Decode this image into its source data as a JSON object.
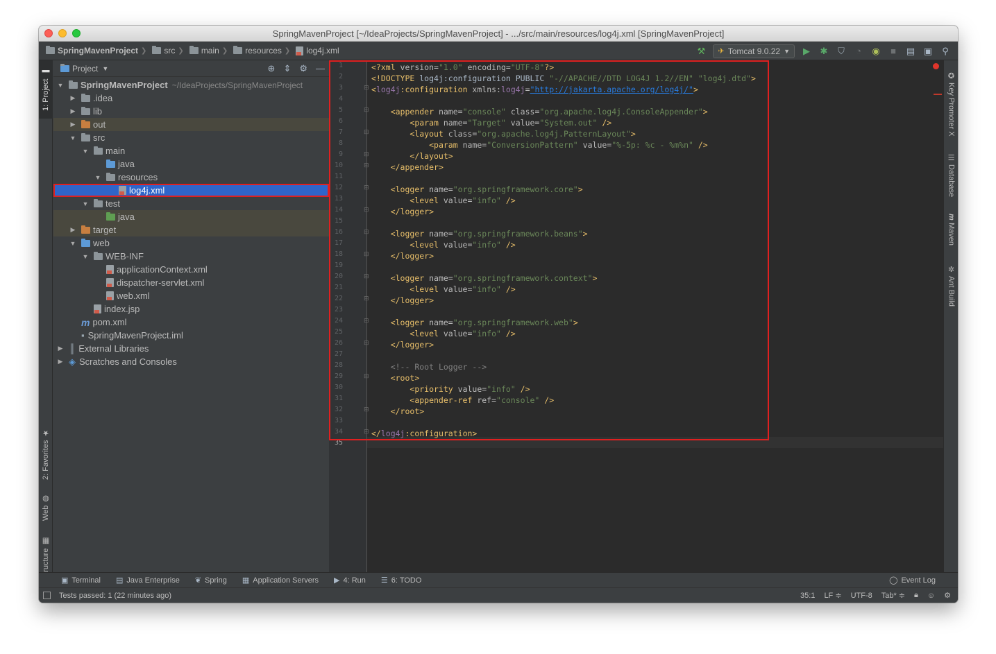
{
  "window": {
    "title": "SpringMavenProject [~/IdeaProjects/SpringMavenProject] - .../src/main/resources/log4j.xml [SpringMavenProject]"
  },
  "breadcrumbs": [
    "SpringMavenProject",
    "src",
    "main",
    "resources",
    "log4j.xml"
  ],
  "toolbar": {
    "run_config": "Tomcat 9.0.22",
    "icons": [
      "hammer-icon",
      "play-icon",
      "bug-icon",
      "coverage-icon",
      "profile-icon",
      "attach-icon",
      "stop-icon",
      "project-structure-icon",
      "frame-icon",
      "search-icon"
    ]
  },
  "left_tabs": [
    "1: Project",
    "2: Favorites",
    "Web",
    "Z: Structure"
  ],
  "right_tabs": [
    "Key Promoter X",
    "Database",
    "Maven",
    "Ant Build"
  ],
  "project_panel": {
    "title": "Project",
    "tree": [
      {
        "label": "SpringMavenProject",
        "hint": "~/IdeaProjects/SpringMavenProject",
        "depth": 0,
        "arrow": "down",
        "icon": "folder",
        "bold": true
      },
      {
        "label": ".idea",
        "depth": 1,
        "arrow": "right",
        "icon": "folder"
      },
      {
        "label": "lib",
        "depth": 1,
        "arrow": "right",
        "icon": "folder"
      },
      {
        "label": "out",
        "depth": 1,
        "arrow": "right",
        "icon": "folder-orange",
        "highlight": true
      },
      {
        "label": "src",
        "depth": 1,
        "arrow": "down",
        "icon": "folder"
      },
      {
        "label": "main",
        "depth": 2,
        "arrow": "down",
        "icon": "folder"
      },
      {
        "label": "java",
        "depth": 3,
        "arrow": "none",
        "icon": "folder-blue"
      },
      {
        "label": "resources",
        "depth": 3,
        "arrow": "down",
        "icon": "folder-res"
      },
      {
        "label": "log4j.xml",
        "depth": 4,
        "arrow": "none",
        "icon": "xml",
        "selected": true
      },
      {
        "label": "test",
        "depth": 2,
        "arrow": "down",
        "icon": "folder"
      },
      {
        "label": "java",
        "depth": 3,
        "arrow": "none",
        "icon": "folder-green",
        "highlight": true
      },
      {
        "label": "target",
        "depth": 1,
        "arrow": "right",
        "icon": "folder-orange",
        "highlight": true
      },
      {
        "label": "web",
        "depth": 1,
        "arrow": "down",
        "icon": "folder-blue"
      },
      {
        "label": "WEB-INF",
        "depth": 2,
        "arrow": "down",
        "icon": "folder"
      },
      {
        "label": "applicationContext.xml",
        "depth": 3,
        "arrow": "none",
        "icon": "xml"
      },
      {
        "label": "dispatcher-servlet.xml",
        "depth": 3,
        "arrow": "none",
        "icon": "xml"
      },
      {
        "label": "web.xml",
        "depth": 3,
        "arrow": "none",
        "icon": "xml"
      },
      {
        "label": "index.jsp",
        "depth": 2,
        "arrow": "none",
        "icon": "xml"
      },
      {
        "label": "pom.xml",
        "depth": 1,
        "arrow": "none",
        "icon": "maven"
      },
      {
        "label": "SpringMavenProject.iml",
        "depth": 1,
        "arrow": "none",
        "icon": "file"
      },
      {
        "label": "External Libraries",
        "depth": 0,
        "arrow": "right",
        "icon": "libs"
      },
      {
        "label": "Scratches and Consoles",
        "depth": 0,
        "arrow": "right",
        "icon": "scratch"
      }
    ]
  },
  "editor": {
    "line_numbers": [
      "1",
      "2",
      "3",
      "4",
      "5",
      "6",
      "7",
      "8",
      "9",
      "10",
      "11",
      "12",
      "13",
      "14",
      "15",
      "16",
      "17",
      "18",
      "19",
      "20",
      "21",
      "22",
      "23",
      "24",
      "25",
      "26",
      "27",
      "28",
      "29",
      "30",
      "31",
      "32",
      "33",
      "34",
      "35"
    ],
    "code_lines": [
      [
        [
          "tag",
          "<?xml "
        ],
        [
          "attr",
          "version="
        ],
        [
          "val",
          "\"1.0\" "
        ],
        [
          "attr",
          "encoding="
        ],
        [
          "val",
          "\"UTF-8\""
        ],
        [
          "tag",
          "?>"
        ]
      ],
      [
        [
          "tag",
          "<!DOCTYPE "
        ],
        [
          "plain",
          "log4j:configuration PUBLIC "
        ],
        [
          "val",
          "\"-//APACHE//DTD LOG4J 1.2//EN\" \"log4j.dtd\""
        ],
        [
          "tag",
          ">"
        ]
      ],
      [
        [
          "tag",
          "<"
        ],
        [
          "ns",
          "log4j"
        ],
        [
          "tag",
          ":configuration "
        ],
        [
          "attr",
          "xmlns:"
        ],
        [
          "ns",
          "log4j"
        ],
        [
          "attr",
          "="
        ],
        [
          "url",
          "\"http://jakarta.apache.org/log4j/\""
        ],
        [
          "tag",
          ">"
        ]
      ],
      [],
      [
        [
          "plain",
          "    "
        ],
        [
          "tag",
          "<appender "
        ],
        [
          "attr",
          "name="
        ],
        [
          "val",
          "\"console\" "
        ],
        [
          "attr",
          "class="
        ],
        [
          "val",
          "\"org.apache.log4j.ConsoleAppender\""
        ],
        [
          "tag",
          ">"
        ]
      ],
      [
        [
          "plain",
          "        "
        ],
        [
          "tag",
          "<param "
        ],
        [
          "attr",
          "name="
        ],
        [
          "val",
          "\"Target\" "
        ],
        [
          "attr",
          "value="
        ],
        [
          "val",
          "\"System.out\" "
        ],
        [
          "tag",
          "/>"
        ]
      ],
      [
        [
          "plain",
          "        "
        ],
        [
          "tag",
          "<layout "
        ],
        [
          "attr",
          "class="
        ],
        [
          "val",
          "\"org.apache.log4j.PatternLayout\""
        ],
        [
          "tag",
          ">"
        ]
      ],
      [
        [
          "plain",
          "            "
        ],
        [
          "tag",
          "<param "
        ],
        [
          "attr",
          "name="
        ],
        [
          "val",
          "\"ConversionPattern\" "
        ],
        [
          "attr",
          "value="
        ],
        [
          "val",
          "\"%-5p: %c - %m%n\" "
        ],
        [
          "tag",
          "/>"
        ]
      ],
      [
        [
          "plain",
          "        "
        ],
        [
          "tag",
          "</layout>"
        ]
      ],
      [
        [
          "plain",
          "    "
        ],
        [
          "tag",
          "</appender>"
        ]
      ],
      [],
      [
        [
          "plain",
          "    "
        ],
        [
          "tag",
          "<logger "
        ],
        [
          "attr",
          "name="
        ],
        [
          "val",
          "\"org.springframework.core\""
        ],
        [
          "tag",
          ">"
        ]
      ],
      [
        [
          "plain",
          "        "
        ],
        [
          "tag",
          "<level "
        ],
        [
          "attr",
          "value="
        ],
        [
          "val",
          "\"info\" "
        ],
        [
          "tag",
          "/>"
        ]
      ],
      [
        [
          "plain",
          "    "
        ],
        [
          "tag",
          "</logger>"
        ]
      ],
      [],
      [
        [
          "plain",
          "    "
        ],
        [
          "tag",
          "<logger "
        ],
        [
          "attr",
          "name="
        ],
        [
          "val",
          "\"org.springframework.beans\""
        ],
        [
          "tag",
          ">"
        ]
      ],
      [
        [
          "plain",
          "        "
        ],
        [
          "tag",
          "<level "
        ],
        [
          "attr",
          "value="
        ],
        [
          "val",
          "\"info\" "
        ],
        [
          "tag",
          "/>"
        ]
      ],
      [
        [
          "plain",
          "    "
        ],
        [
          "tag",
          "</logger>"
        ]
      ],
      [],
      [
        [
          "plain",
          "    "
        ],
        [
          "tag",
          "<logger "
        ],
        [
          "attr",
          "name="
        ],
        [
          "val",
          "\"org.springframework.context\""
        ],
        [
          "tag",
          ">"
        ]
      ],
      [
        [
          "plain",
          "        "
        ],
        [
          "tag",
          "<level "
        ],
        [
          "attr",
          "value="
        ],
        [
          "val",
          "\"info\" "
        ],
        [
          "tag",
          "/>"
        ]
      ],
      [
        [
          "plain",
          "    "
        ],
        [
          "tag",
          "</logger>"
        ]
      ],
      [],
      [
        [
          "plain",
          "    "
        ],
        [
          "tag",
          "<logger "
        ],
        [
          "attr",
          "name="
        ],
        [
          "val",
          "\"org.springframework.web\""
        ],
        [
          "tag",
          ">"
        ]
      ],
      [
        [
          "plain",
          "        "
        ],
        [
          "tag",
          "<level "
        ],
        [
          "attr",
          "value="
        ],
        [
          "val",
          "\"info\" "
        ],
        [
          "tag",
          "/>"
        ]
      ],
      [
        [
          "plain",
          "    "
        ],
        [
          "tag",
          "</logger>"
        ]
      ],
      [],
      [
        [
          "plain",
          "    "
        ],
        [
          "cmt",
          "<!-- Root Logger -->"
        ]
      ],
      [
        [
          "plain",
          "    "
        ],
        [
          "tag",
          "<root>"
        ]
      ],
      [
        [
          "plain",
          "        "
        ],
        [
          "tag",
          "<priority "
        ],
        [
          "attr",
          "value="
        ],
        [
          "val",
          "\"info\" "
        ],
        [
          "tag",
          "/>"
        ]
      ],
      [
        [
          "plain",
          "        "
        ],
        [
          "tag",
          "<appender-ref "
        ],
        [
          "attr",
          "ref="
        ],
        [
          "val",
          "\"console\" "
        ],
        [
          "tag",
          "/>"
        ]
      ],
      [
        [
          "plain",
          "    "
        ],
        [
          "tag",
          "</root>"
        ]
      ],
      [],
      [
        [
          "tag",
          "</"
        ],
        [
          "ns",
          "log4j"
        ],
        [
          "tag",
          ":configuration>"
        ]
      ],
      []
    ],
    "fold_lines": [
      3,
      5,
      7,
      9,
      10,
      12,
      14,
      16,
      18,
      20,
      22,
      24,
      26,
      29,
      32,
      34
    ]
  },
  "bottom_tabs": [
    {
      "label": "Terminal",
      "icon": "terminal-icon"
    },
    {
      "label": "Java Enterprise",
      "icon": "java-enterprise-icon"
    },
    {
      "label": "Spring",
      "icon": "spring-icon"
    },
    {
      "label": "Application Servers",
      "icon": "app-servers-icon"
    },
    {
      "label": "4: Run",
      "icon": "run-icon"
    },
    {
      "label": "6: TODO",
      "icon": "todo-icon"
    }
  ],
  "event_log": "Event Log",
  "status": {
    "message": "Tests passed: 1 (22 minutes ago)",
    "position": "35:1",
    "line_sep": "LF ≑",
    "encoding": "UTF-8",
    "indent": "Tab* ≑"
  },
  "colors": {
    "tag": "#e8bf6a",
    "attribute": "#bababa",
    "value": "#6a8759",
    "namespace": "#9876aa",
    "selection": "#2f65ca",
    "annotation_box": "#e02020"
  }
}
